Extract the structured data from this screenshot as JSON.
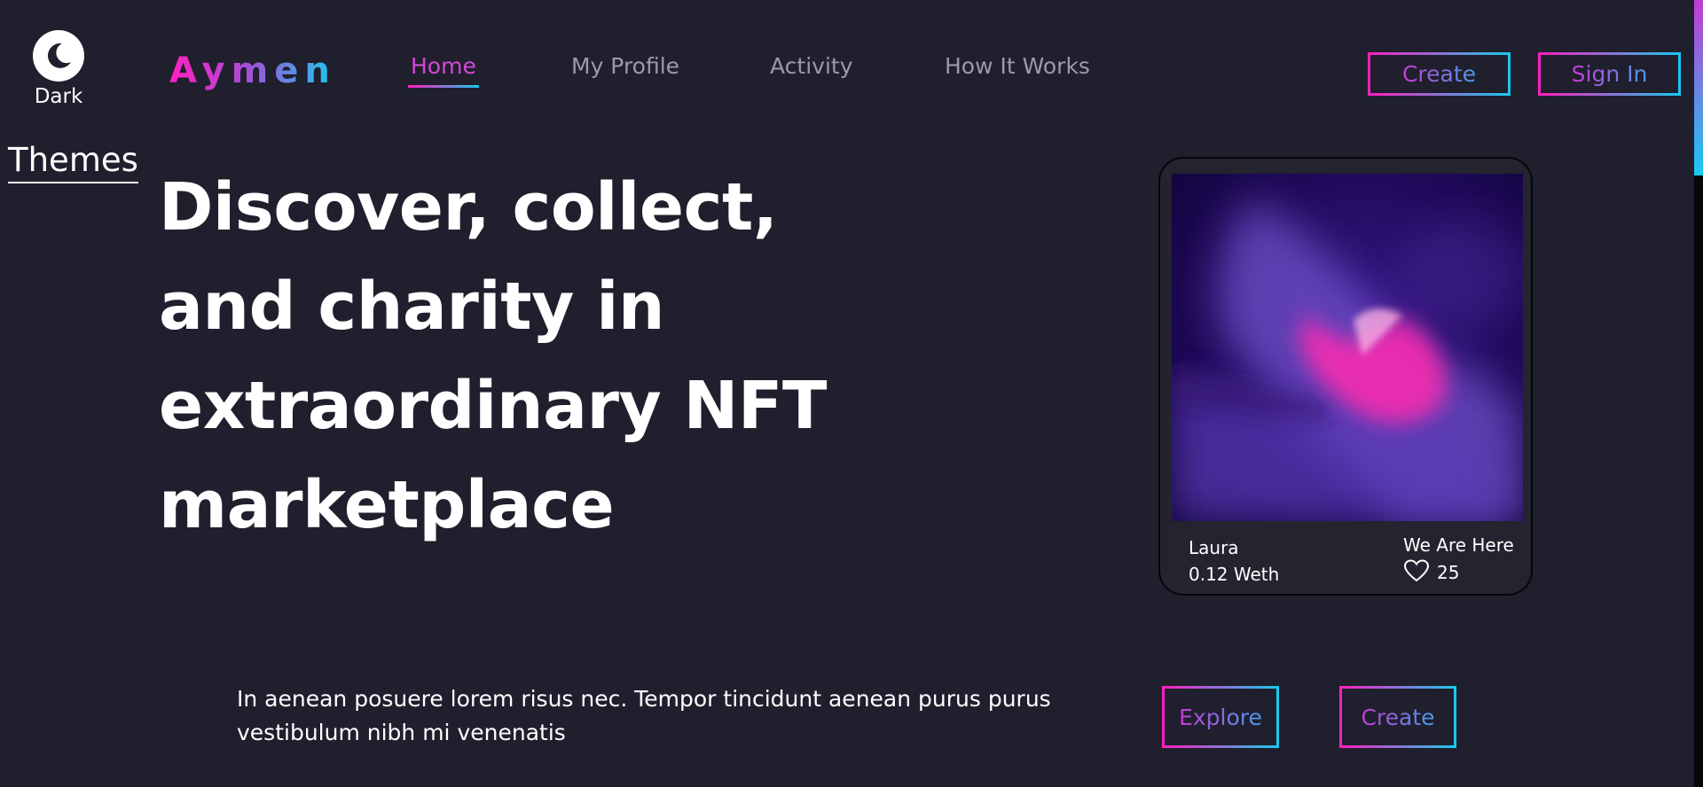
{
  "theme": {
    "label": "Dark",
    "themes_label": "Themes",
    "icon": "moon-icon"
  },
  "brand": {
    "name": "Aymen"
  },
  "nav": {
    "items": [
      {
        "label": "Home",
        "active": true
      },
      {
        "label": "My Profile",
        "active": false
      },
      {
        "label": "Activity",
        "active": false
      },
      {
        "label": "How It Works",
        "active": false
      }
    ]
  },
  "header_buttons": {
    "create": "Create",
    "sign_in": "Sign In"
  },
  "hero": {
    "headline": "Discover, collect, and charity in extraordinary NFT marketplace",
    "description": "In aenean posuere lorem risus nec. Tempor tincidunt aenean purus purus vestibulum nibh mi venenatis",
    "explore_button": "Explore",
    "create_button": "Create"
  },
  "nft_card": {
    "owner": "Laura",
    "price": "0.12 Weth",
    "title": "We Are Here",
    "likes": "25",
    "like_icon": "heart-icon"
  },
  "colors": {
    "background": "#201f2d",
    "accent_pink": "#ff1fbf",
    "accent_cyan": "#19c9f0",
    "active_nav": "#d348d6",
    "inactive_nav": "#9b9aa6"
  }
}
